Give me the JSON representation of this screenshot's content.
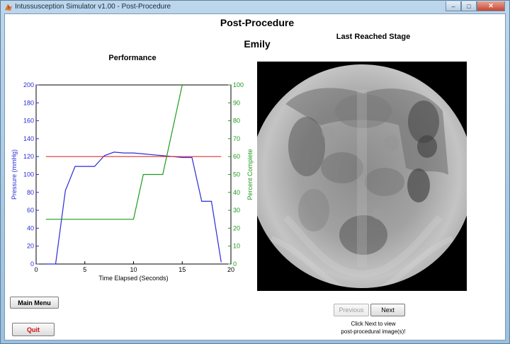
{
  "window": {
    "title": "Intussusception Simulator v1.00 - Post-Procedure",
    "controls": {
      "minimize": "–",
      "maximize": "□",
      "close": "✕"
    }
  },
  "page": {
    "title": "Post-Procedure",
    "user_name": "Emily",
    "performance_title": "Performance",
    "stage_title": "Last Reached Stage"
  },
  "buttons": {
    "main_menu": "Main Menu",
    "quit": "Quit",
    "previous": "Previous",
    "next": "Next"
  },
  "hint": {
    "line1": "Click Next to view",
    "line2": "post-procedural image(s)!"
  },
  "colors": {
    "pressure": "#2b2bd8",
    "percent": "#1e9a1e",
    "threshold": "#e03030",
    "quit_text": "#d01010"
  },
  "chart_data": {
    "type": "line",
    "xlabel": "Time Elapsed (Seconds)",
    "ylabel": "Pressure (mmHg)",
    "y2label": "Percent Complete",
    "xlim": [
      0,
      20
    ],
    "ylim": [
      0,
      200
    ],
    "y2lim": [
      0,
      100
    ],
    "xticks": [
      "0",
      "5",
      "10",
      "15",
      "20"
    ],
    "yticks": [
      "0",
      "20",
      "40",
      "60",
      "80",
      "100",
      "120",
      "140",
      "160",
      "180",
      "200"
    ],
    "y2ticks": [
      "0",
      "10",
      "20",
      "30",
      "40",
      "50",
      "60",
      "70",
      "80",
      "90",
      "100"
    ],
    "series": [
      {
        "axis": "left",
        "color": "#2b2bd8",
        "x": [
          1,
          2,
          3,
          4,
          5,
          6,
          7,
          8,
          9,
          10,
          11,
          12,
          13,
          14,
          15,
          16,
          17,
          18,
          19
        ],
        "y": [
          0,
          0,
          82,
          109,
          109,
          109,
          121,
          125,
          124,
          124,
          123,
          122,
          121,
          120,
          119,
          119,
          70,
          70,
          2
        ]
      },
      {
        "axis": "right",
        "color": "#1e9a1e",
        "x": [
          1,
          10,
          11,
          13,
          15
        ],
        "y": [
          25,
          25,
          50,
          50,
          100
        ]
      },
      {
        "axis": "left",
        "color": "#e03030",
        "x": [
          1,
          19
        ],
        "y": [
          120,
          120
        ]
      }
    ]
  }
}
